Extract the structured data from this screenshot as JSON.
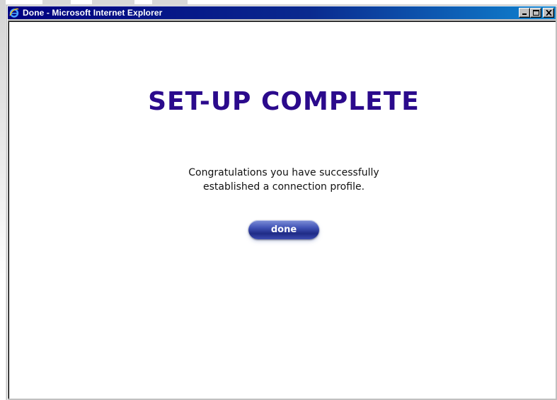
{
  "window": {
    "title": "Done - Microsoft Internet Explorer",
    "controls": {
      "minimize": "minimize",
      "maximize": "maximize",
      "close": "close"
    },
    "icon": "ie-logo-icon"
  },
  "page": {
    "headline": "SET-UP COMPLETE",
    "message_line1": "Congratulations you have successfully",
    "message_line2": "established a connection profile.",
    "done_button": "done"
  },
  "colors": {
    "titlebar_start": "#000080",
    "titlebar_end": "#1084d0",
    "headline": "#2b0a8c",
    "button": "#3c4bb0"
  }
}
